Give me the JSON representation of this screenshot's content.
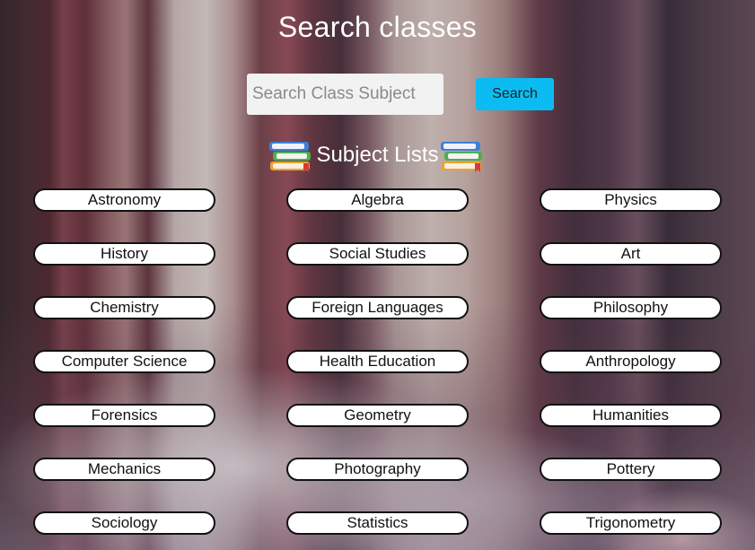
{
  "page": {
    "title": "Search classes"
  },
  "search": {
    "placeholder": "Search Class Subject",
    "button_label": "Search",
    "button_color": "#0bbcf2"
  },
  "subjects_section": {
    "heading": "Subject Lists",
    "icon": "books-icon"
  },
  "subjects": [
    "Astronomy",
    "Algebra",
    "Physics",
    "History",
    "Social Studies",
    "Art",
    "Chemistry",
    "Foreign Languages",
    "Philosophy",
    "Computer Science",
    "Health Education",
    "Anthropology",
    "Forensics",
    "Geometry",
    "Humanities",
    "Mechanics",
    "Photography",
    "Pottery",
    "Sociology",
    "Statistics",
    "Trigonometry"
  ]
}
